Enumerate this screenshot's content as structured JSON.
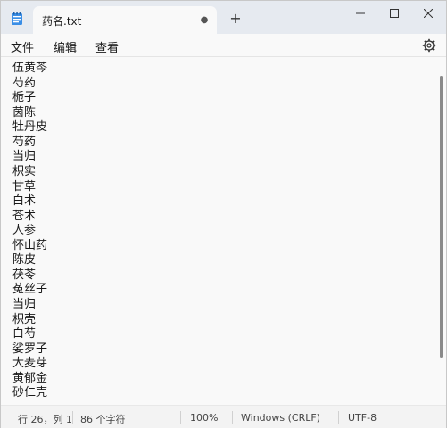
{
  "tab": {
    "title": "药名.txt",
    "unsaved_marker": "●",
    "new_tab": "+"
  },
  "menu": {
    "file": "文件",
    "edit": "编辑",
    "view": "查看"
  },
  "editor": {
    "lines": [
      "伍黄芩",
      "芍药",
      "栀子",
      "茵陈",
      "牡丹皮",
      "芍药",
      "当归",
      "枳实",
      "甘草",
      "白术",
      "苍术",
      "人参",
      "怀山药",
      "陈皮",
      "茯苓",
      "菟丝子",
      "当归",
      "枳壳",
      "白芍",
      "娑罗子",
      "大麦芽",
      "黄郁金",
      "砂仁壳"
    ]
  },
  "status": {
    "position": "行 26，列 1",
    "char_count": "86 个字符",
    "zoom": "100%",
    "line_ending": "Windows (CRLF)",
    "encoding": "UTF-8"
  }
}
